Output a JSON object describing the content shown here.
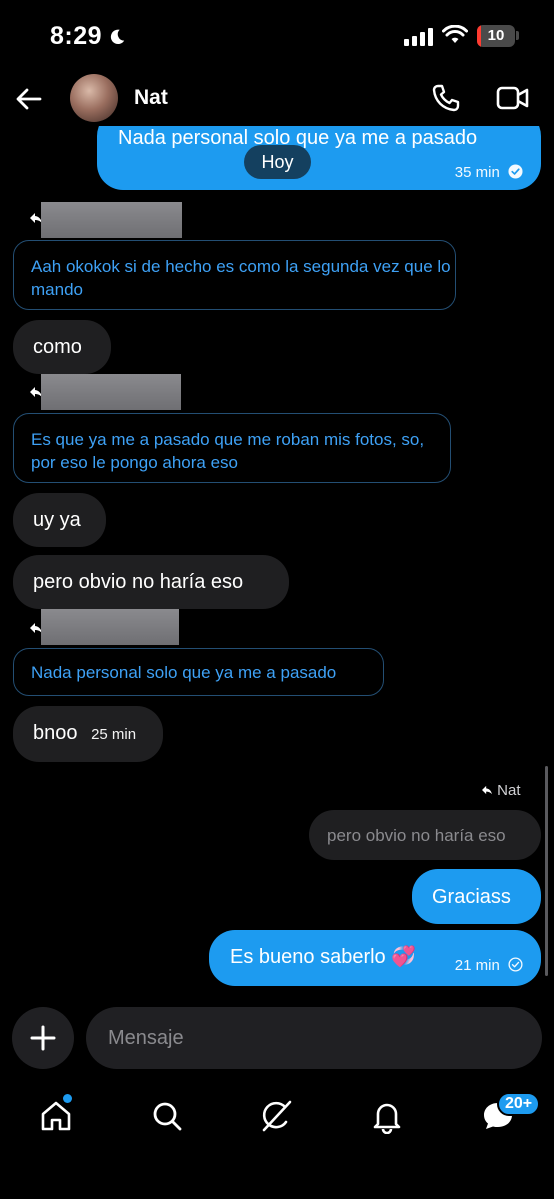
{
  "status_bar": {
    "time": "8:29",
    "battery": "10",
    "battery_level_percent": 10
  },
  "header": {
    "contact_name": "Nat"
  },
  "chat": {
    "top_message": {
      "text": "Nada personal solo que ya me a pasado",
      "time": "35 min"
    },
    "date_pill": "Hoy",
    "messages": [
      {
        "type": "quote",
        "text": "Aah okokok si de hecho es como la segunda vez que lo mando"
      },
      {
        "type": "incoming",
        "text": "como"
      },
      {
        "type": "quote",
        "text": "Es que ya me a pasado que me roban mis fotos, so, por eso le pongo ahora eso"
      },
      {
        "type": "incoming",
        "text": "uy ya"
      },
      {
        "type": "incoming",
        "text": "pero obvio no haría eso"
      },
      {
        "type": "quote",
        "text": "Nada personal solo que ya me a pasado"
      },
      {
        "type": "incoming",
        "text": "bnoo",
        "time": "25 min"
      }
    ],
    "reply_to_label": "Nat",
    "quoted_outgoing": "pero obvio no haría eso",
    "outgoing_1": "Graciass",
    "outgoing_2": {
      "text": "Es bueno saberlo 💞",
      "time": "21 min"
    }
  },
  "composer": {
    "placeholder": "Mensaje"
  },
  "nav": {
    "messages_badge": "20+"
  },
  "colors": {
    "accent": "#1d9bf0",
    "incoming_bubble": "#1f1f21",
    "background": "#000000",
    "quote_text": "#3ea1f5"
  },
  "icons": [
    "back-arrow-icon",
    "phone-icon",
    "video-camera-icon",
    "plus-icon",
    "home-icon",
    "search-icon",
    "grok-icon",
    "bell-icon",
    "messages-icon",
    "check-circle-icon",
    "reply-arrow-icon",
    "moon-icon",
    "signal-icon",
    "wifi-icon",
    "battery-icon"
  ]
}
